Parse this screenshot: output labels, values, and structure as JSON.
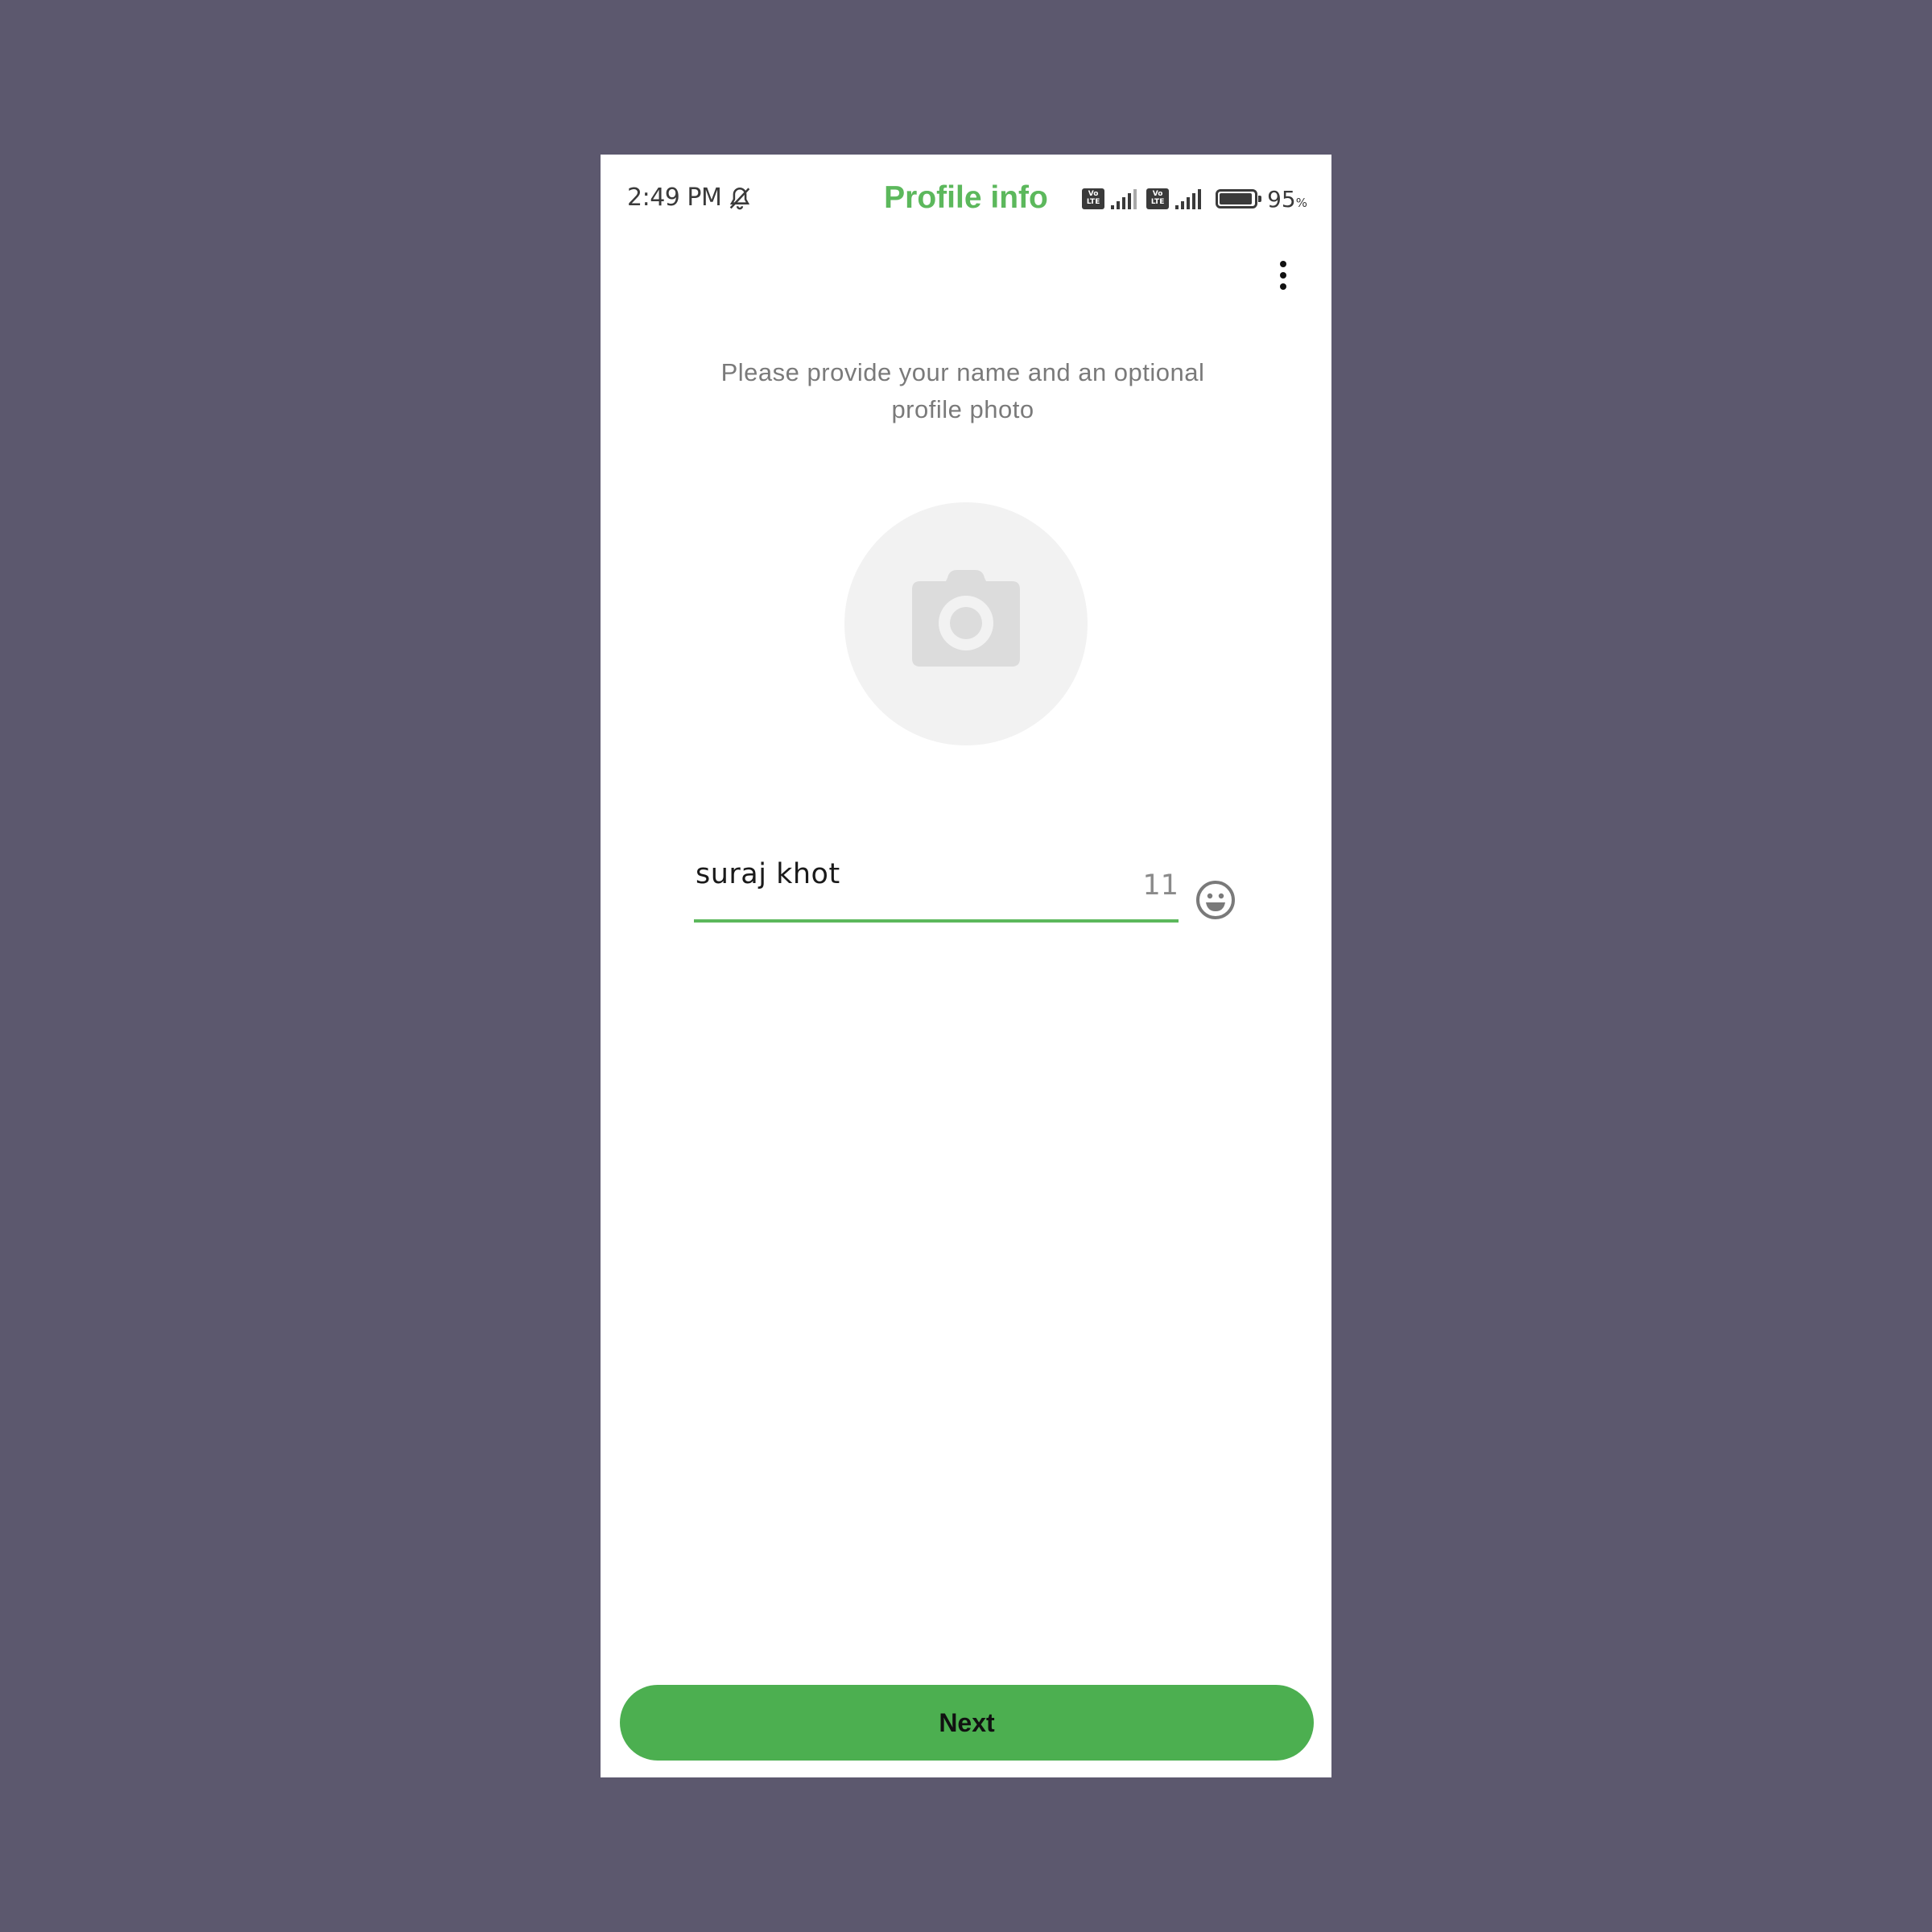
{
  "status_bar": {
    "time": "2:49 PM",
    "volte_label": "Vo LTE",
    "battery_percent": "95",
    "battery_unit": "%",
    "battery_level": 0.95,
    "icons": [
      "bell-off-icon",
      "volte-icon",
      "signal-icon",
      "volte-icon",
      "signal-icon",
      "battery-icon"
    ]
  },
  "app_bar": {
    "title": "Profile info",
    "menu_icon": "more-vert-icon"
  },
  "main": {
    "instruction": "Please provide your name and an optional profile photo",
    "photo_icon": "camera-icon",
    "name_value": "suraj khot",
    "char_remaining": "11",
    "emoji_icon": "emoji-icon"
  },
  "footer": {
    "next_label": "Next"
  },
  "colors": {
    "background": "#5c586e",
    "accent": "#5cb85c",
    "button": "#4caf50",
    "placeholder_circle": "#f2f2f2",
    "camera": "#dcdcdc"
  }
}
